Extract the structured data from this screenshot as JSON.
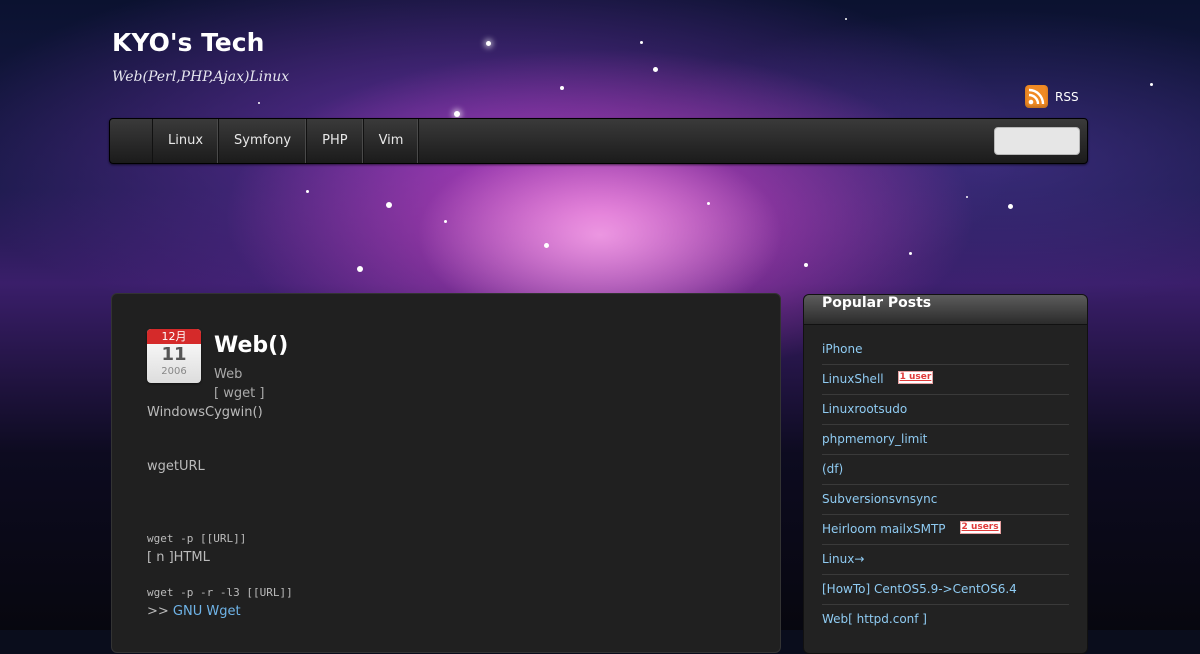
{
  "site": {
    "title": "KYO's Tech",
    "tagline": "Web(Perl,PHP,Ajax)Linux"
  },
  "rss": {
    "label": "RSS",
    "icon": "rss-icon",
    "color": "#f08a24"
  },
  "nav": {
    "items": [
      {
        "label": "Linux"
      },
      {
        "label": "Symfony"
      },
      {
        "label": "PHP"
      },
      {
        "label": "Vim"
      }
    ],
    "search_value": ""
  },
  "post": {
    "date": {
      "month": "12月",
      "day": "11",
      "year": "2006"
    },
    "title": "Web()",
    "category": "Web",
    "tags": "[ wget ]",
    "lines": [
      "WindowsCygwin()",
      "wgetURL",
      "wget -p [[URL]]",
      "[ n ]HTML",
      "wget -p -r -l3 [[URL]]",
      ">> ",
      "GNU Wget"
    ]
  },
  "sidebar": {
    "heading": "Popular Posts",
    "posts": [
      {
        "title": "iPhone",
        "badge": ""
      },
      {
        "title": "LinuxShell",
        "badge": "1 user"
      },
      {
        "title": "Linuxrootsudo",
        "badge": ""
      },
      {
        "title": "phpmemory_limit",
        "badge": ""
      },
      {
        "title": "(df)",
        "badge": ""
      },
      {
        "title": "Subversionsvnsync",
        "badge": ""
      },
      {
        "title": "Heirloom mailxSMTP",
        "badge": "2 users"
      },
      {
        "title": "Linux→",
        "badge": ""
      },
      {
        "title": "[HowTo] CentOS5.9->CentOS6.4",
        "badge": ""
      },
      {
        "title": "Web[ httpd.conf ]",
        "badge": ""
      }
    ]
  },
  "colors": {
    "link": "#8fcbf2",
    "date_header": "#d52a2a",
    "badge_text": "#e03a3a"
  }
}
